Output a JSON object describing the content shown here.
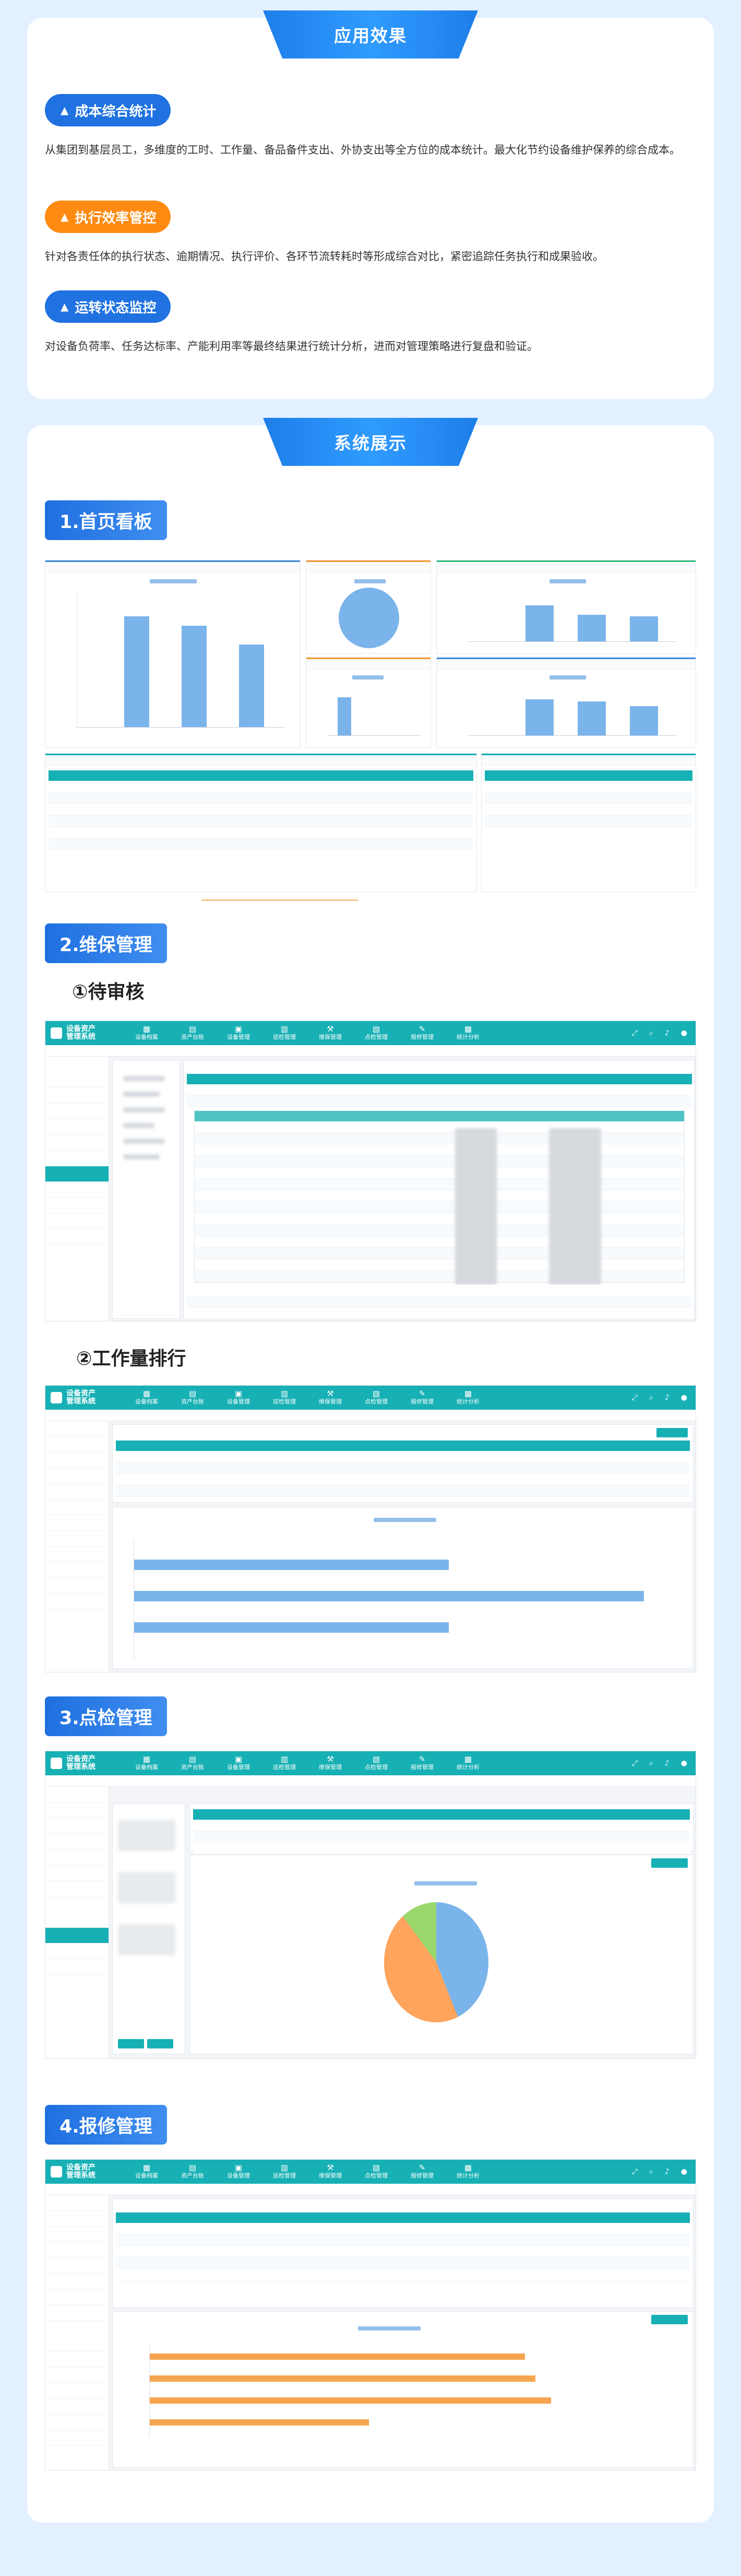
{
  "effects": {
    "title": "应用效果",
    "items": [
      {
        "label": "成本综合统计",
        "color": "#1f72e0",
        "text": "从集团到基层员工，多维度的工时、工作量、备品备件支出、外协支出等全方位的成本统计。最大化节约设备维护保养的综合成本。"
      },
      {
        "label": "执行效率管控",
        "color": "#ff8a12",
        "text": "针对各责任体的执行状态、逾期情况、执行评价、各环节流转耗时等形成综合对比，紧密追踪任务执行和成果验收。"
      },
      {
        "label": "运转状态监控",
        "color": "#1f72e0",
        "text": "对设备负荷率、任务达标率、产能利用率等最终结果进行统计分析，进而对管理策略进行复盘和验证。"
      }
    ]
  },
  "display": {
    "title": "系统展示",
    "sections": {
      "s1": "1.首页看板",
      "s2": "2.维保管理",
      "s2a": "①待审核",
      "s2b": "②工作量排行",
      "s3": "3.点检管理",
      "s4": "4.报修管理"
    }
  },
  "screens": {
    "app_name_line1": "设备资产",
    "app_name_line2": "管理系统",
    "nav": [
      "设备档案",
      "资产台账",
      "设备管理",
      "维保管理",
      "巡检管理",
      "点检管理",
      "报修管理",
      "统计分析"
    ],
    "dashboard_chart1_values": [
      12000,
      11000,
      9000
    ],
    "dashboard_chart3_values": [
      9000,
      6500,
      6000
    ],
    "dashboard_chart4_values": [
      4500,
      0,
      0
    ],
    "dashboard_chart5_values": [
      4000,
      3800,
      3300
    ],
    "workload_bars": [
      0.58,
      0.94,
      0.58
    ],
    "pie_slices": [
      {
        "color": "#7bb4ea",
        "value": 44
      },
      {
        "color": "#ffa45c",
        "value": 46
      },
      {
        "color": "#9ad86e",
        "value": 10
      }
    ],
    "repair_bars": [
      0.72,
      0.74,
      0.77,
      0.42
    ]
  }
}
